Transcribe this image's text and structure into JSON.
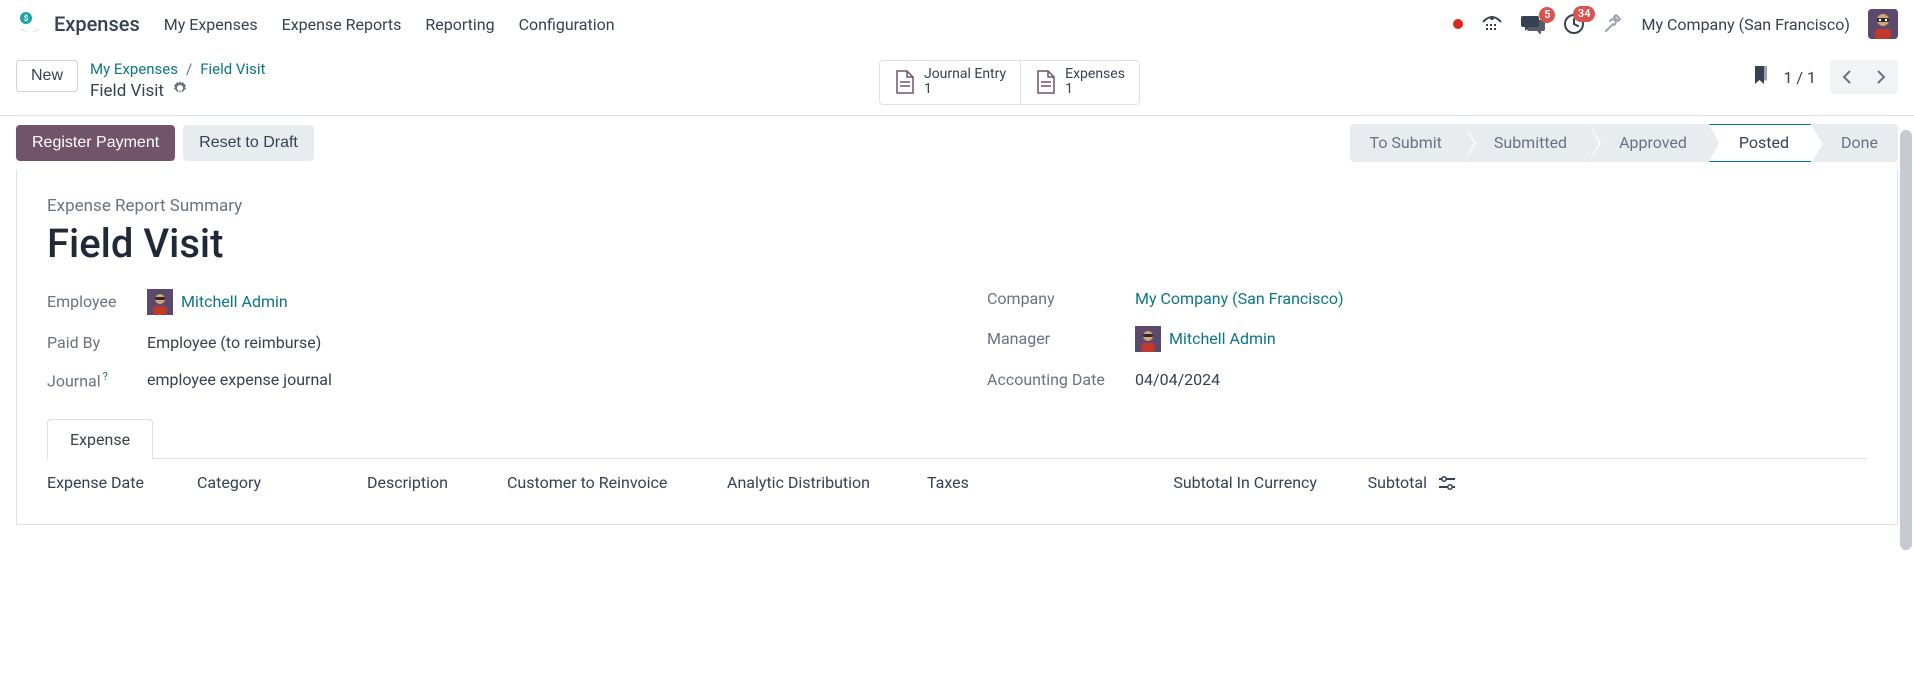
{
  "nav": {
    "app_title": "Expenses",
    "menu": [
      "My Expenses",
      "Expense Reports",
      "Reporting",
      "Configuration"
    ],
    "badges": {
      "messages": "5",
      "activities": "34"
    },
    "company": "My Company (San Francisco)"
  },
  "controlbar": {
    "new_label": "New",
    "breadcrumb": [
      "My Expenses",
      "Field Visit"
    ],
    "record_name": "Field Visit",
    "stat_buttons": [
      {
        "label": "Journal Entry",
        "count": "1"
      },
      {
        "label": "Expenses",
        "count": "1"
      }
    ],
    "pager": "1 / 1"
  },
  "actions": {
    "register_payment": "Register Payment",
    "reset_draft": "Reset to Draft"
  },
  "status": {
    "steps": [
      "To Submit",
      "Submitted",
      "Approved",
      "Posted",
      "Done"
    ],
    "active_index": 3
  },
  "form": {
    "summary_label": "Expense Report Summary",
    "title": "Field Visit",
    "left": {
      "employee_label": "Employee",
      "employee_value": "Mitchell Admin",
      "paid_by_label": "Paid By",
      "paid_by_value": "Employee (to reimburse)",
      "journal_label": "Journal",
      "journal_help": "?",
      "journal_value": "employee expense journal"
    },
    "right": {
      "company_label": "Company",
      "company_value": "My Company (San Francisco)",
      "manager_label": "Manager",
      "manager_value": "Mitchell Admin",
      "acct_date_label": "Accounting Date",
      "acct_date_value": "04/04/2024"
    }
  },
  "tabs": {
    "expense": "Expense"
  },
  "table": {
    "headers": [
      "Expense Date",
      "Category",
      "Description",
      "Customer to Reinvoice",
      "Analytic Distribution",
      "Taxes",
      "Subtotal In Currency",
      "Subtotal"
    ]
  }
}
